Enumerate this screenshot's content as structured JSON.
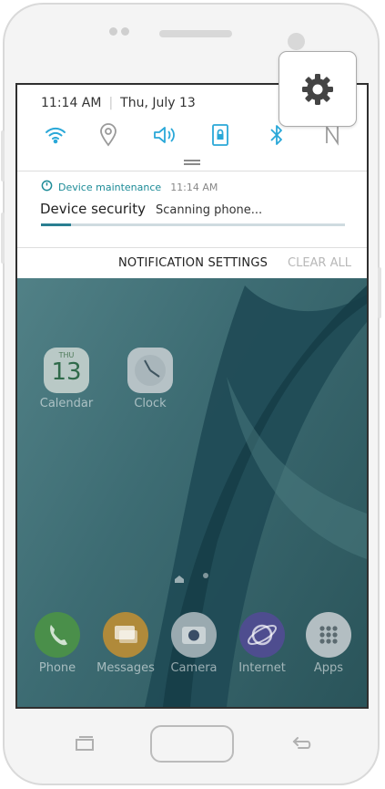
{
  "status_bar": {
    "time": "11:14 AM",
    "separator": "|",
    "date": "Thu, July 13"
  },
  "quick_settings": [
    {
      "name": "wifi-icon",
      "active": true
    },
    {
      "name": "location-icon",
      "active": false
    },
    {
      "name": "sound-icon",
      "active": true
    },
    {
      "name": "screen-rotation-lock-icon",
      "active": true
    },
    {
      "name": "bluetooth-icon",
      "active": true
    },
    {
      "name": "nfc-icon",
      "active": false
    }
  ],
  "notification": {
    "app_name": "Device maintenance",
    "time": "11:14 AM",
    "title": "Device security",
    "text": "Scanning phone...",
    "progress": 0.1
  },
  "panel_actions": {
    "settings": "NOTIFICATION SETTINGS",
    "clear": "CLEAR ALL"
  },
  "home_apps": [
    {
      "label": "Calendar",
      "day_name": "THU",
      "day": "13"
    },
    {
      "label": "Clock"
    }
  ],
  "dock_apps": [
    {
      "label": "Phone"
    },
    {
      "label": "Messages"
    },
    {
      "label": "Camera"
    },
    {
      "label": "Internet"
    },
    {
      "label": "Apps"
    }
  ],
  "colors": {
    "accent": "#1c8b97",
    "active_icon": "#2aa8d8",
    "inactive_icon": "#9a9a9a"
  }
}
